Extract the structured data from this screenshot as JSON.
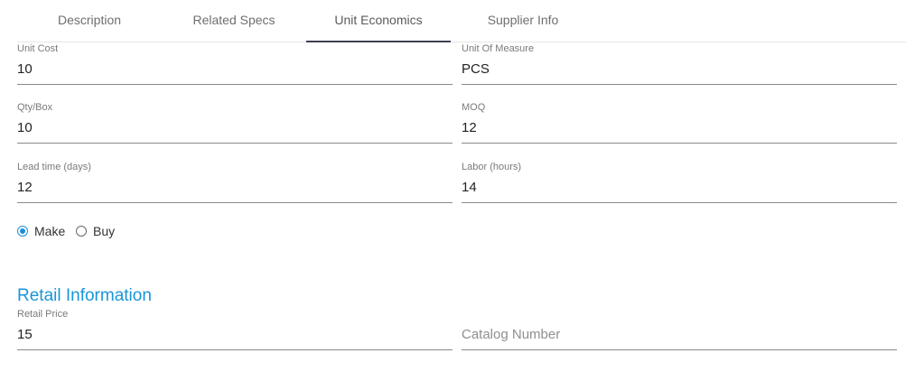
{
  "tabs": [
    {
      "label": "Description",
      "active": false
    },
    {
      "label": "Related Specs",
      "active": false
    },
    {
      "label": "Unit Economics",
      "active": true
    },
    {
      "label": "Supplier Info",
      "active": false
    }
  ],
  "fields": {
    "unit_cost": {
      "label": "Unit Cost",
      "value": "10"
    },
    "unit_of_measure": {
      "label": "Unit Of Measure",
      "value": "PCS"
    },
    "qty_box": {
      "label": "Qty/Box",
      "value": "10"
    },
    "moq": {
      "label": "MOQ",
      "value": "12"
    },
    "lead_time": {
      "label": "Lead time (days)",
      "value": "12"
    },
    "labor": {
      "label": "Labor (hours)",
      "value": "14"
    },
    "retail_price": {
      "label": "Retail Price",
      "value": "15"
    },
    "catalog_number": {
      "placeholder": "Catalog Number",
      "value": ""
    }
  },
  "make_buy": {
    "options": [
      {
        "label": "Make",
        "checked": true
      },
      {
        "label": "Buy",
        "checked": false
      }
    ]
  },
  "retail_section": {
    "title": "Retail Information"
  },
  "colors": {
    "accent": "#1a95d6",
    "tab_indicator": "#3e3e54",
    "underline": "#8a8a8a"
  }
}
